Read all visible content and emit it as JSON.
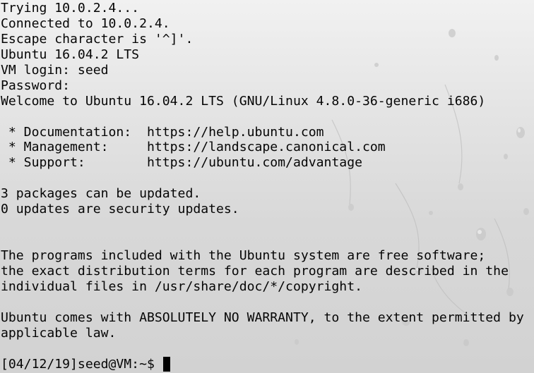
{
  "terminal": {
    "lines": [
      "Trying 10.0.2.4...",
      "Connected to 10.0.2.4.",
      "Escape character is '^]'.",
      "Ubuntu 16.04.2 LTS",
      "VM login: seed",
      "Password:",
      "Welcome to Ubuntu 16.04.2 LTS (GNU/Linux 4.8.0-36-generic i686)",
      "",
      " * Documentation:  https://help.ubuntu.com",
      " * Management:     https://landscape.canonical.com",
      " * Support:        https://ubuntu.com/advantage",
      "",
      "3 packages can be updated.",
      "0 updates are security updates.",
      "",
      "",
      "The programs included with the Ubuntu system are free software;",
      "the exact distribution terms for each program are described in the",
      "individual files in /usr/share/doc/*/copyright.",
      "",
      "Ubuntu comes with ABSOLUTELY NO WARRANTY, to the extent permitted by",
      "applicable law.",
      ""
    ],
    "prompt": "[04/12/19]seed@VM:~$ "
  }
}
